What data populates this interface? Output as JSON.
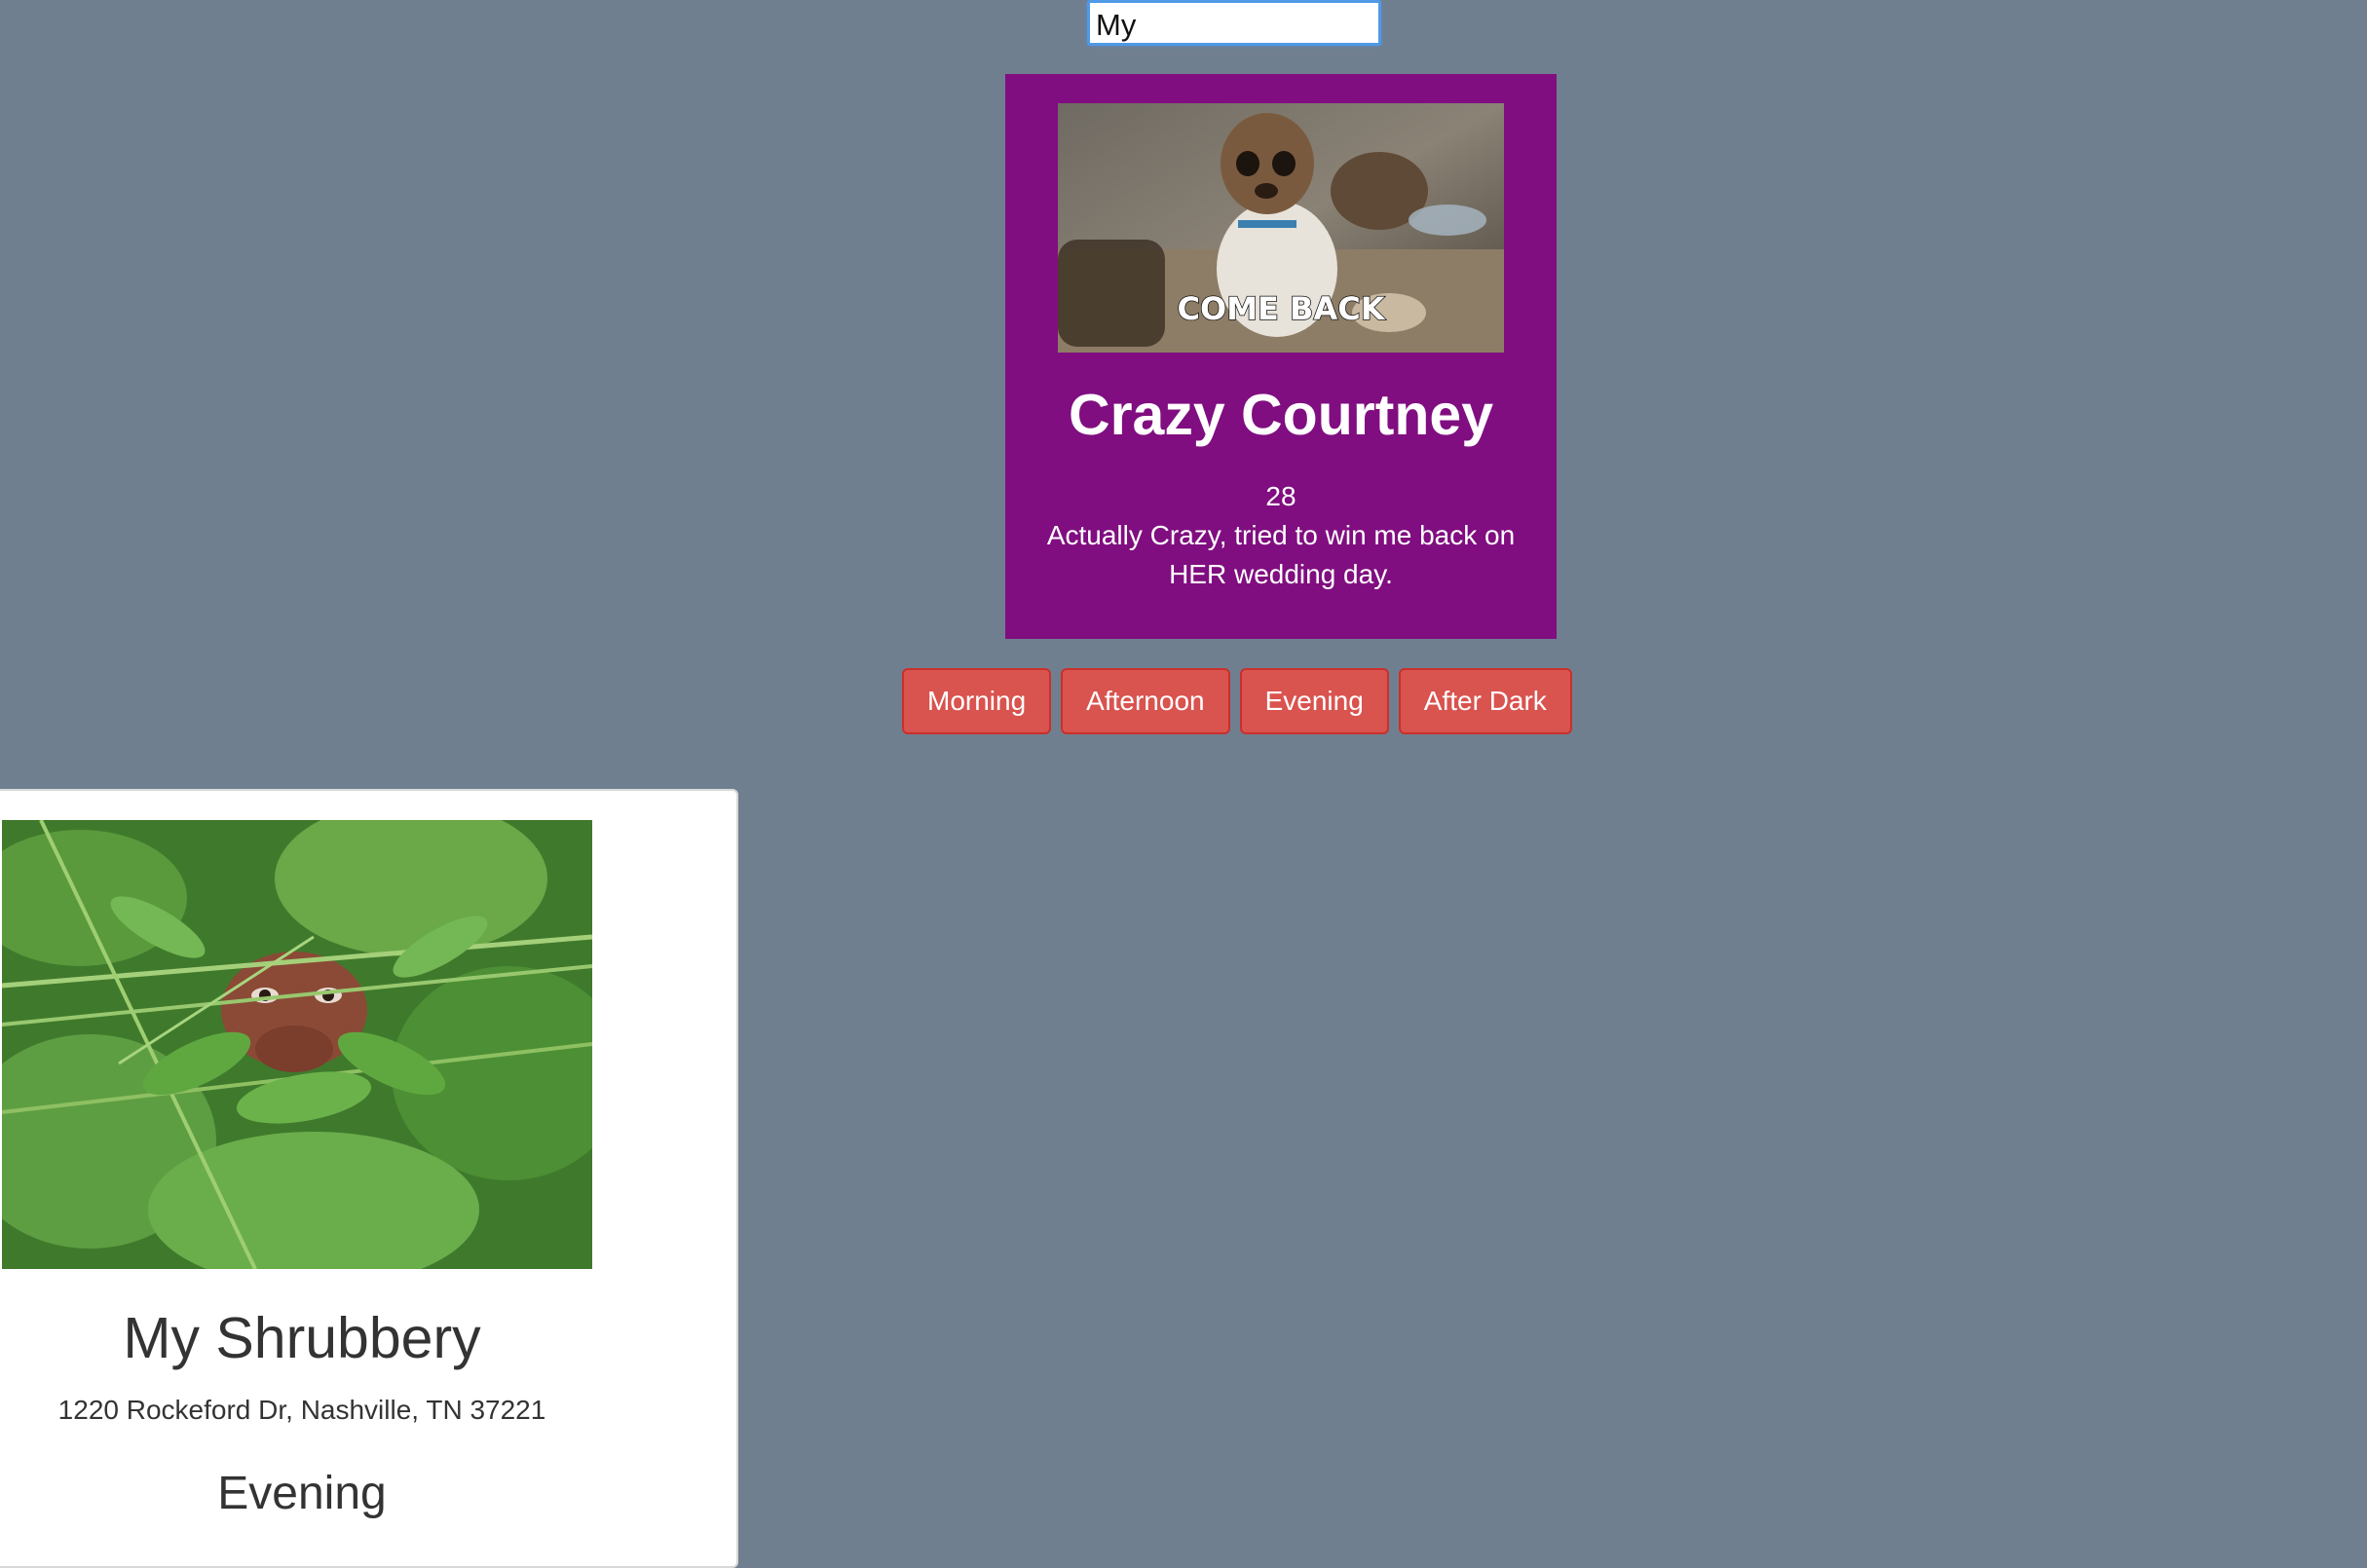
{
  "search": {
    "value": "My"
  },
  "feature_card": {
    "image_caption": "COME BACK",
    "name": "Crazy Courtney",
    "age": "28",
    "description": "Actually Crazy, tried to win me back on HER wedding day.",
    "background_color": "#800e80"
  },
  "time_buttons": [
    {
      "label": "Morning"
    },
    {
      "label": "Afternoon"
    },
    {
      "label": "Evening"
    },
    {
      "label": "After Dark"
    }
  ],
  "result_card": {
    "name": "My Shrubbery",
    "address": "1220 Rockeford Dr, Nashville, TN 37221",
    "time_of_day": "Evening"
  },
  "colors": {
    "page_background": "#707f8f",
    "button": "#d9534f",
    "input_focus": "#4f9ae8"
  }
}
